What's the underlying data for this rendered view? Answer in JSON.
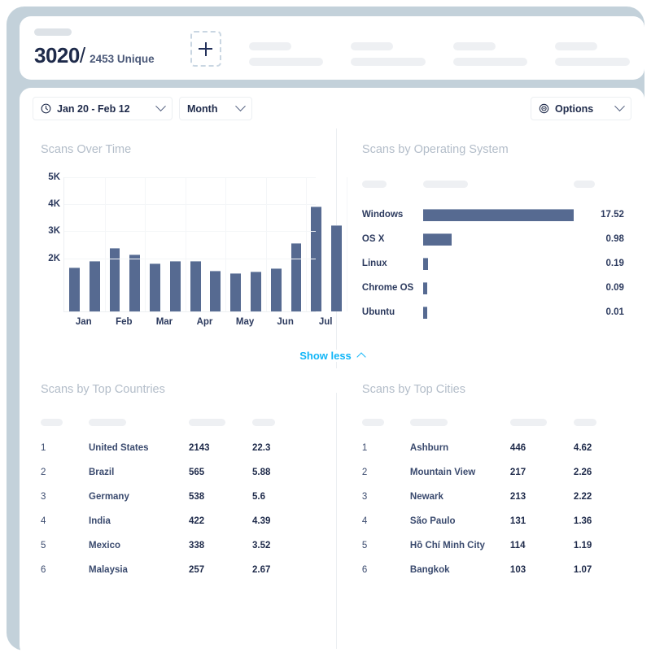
{
  "summary": {
    "total": "3020",
    "slash": "/",
    "unique": "2453 Unique",
    "add_icon": "plus-square-dashed-icon"
  },
  "toolbar": {
    "date_range": "Jan 20 - Feb 12",
    "granularity": "Month",
    "options": "Options",
    "clock_icon": "clock-icon",
    "gear_icon": "gear-icon",
    "chevron_icon": "chevron-down-icon"
  },
  "show_less": {
    "label": "Show less",
    "icon": "chevron-up-icon"
  },
  "colors": {
    "bar": "#566a91",
    "accent": "#12b6f7",
    "frame": "#c3d1da",
    "text_dark": "#1e2a4a",
    "title_muted": "#b3bdc9"
  },
  "sections": {
    "over_time": "Scans Over Time",
    "os": "Scans by Operating System",
    "countries": "Scans by Top Countries",
    "cities": "Scans by Top Cities"
  },
  "chart_data": [
    {
      "type": "bar",
      "title": "Scans Over Time",
      "xlabel": "",
      "ylabel": "",
      "ylim": [
        0,
        5000
      ],
      "yticks": [
        2000,
        3000,
        4000,
        5000
      ],
      "ytick_labels": [
        "2K",
        "3K",
        "4K",
        "5K"
      ],
      "grid": true,
      "categories": [
        "Jan",
        "Feb",
        "Mar",
        "Apr",
        "May",
        "Jun",
        "Jul"
      ],
      "values": [
        1620,
        1880,
        2340,
        2100,
        1770,
        1870,
        1860,
        1500,
        1410,
        1490,
        1600,
        2520,
        3900,
        3200
      ],
      "bar_values": [
        1620,
        1880,
        2340,
        2100,
        1770,
        1870,
        1860,
        1500,
        1410,
        1490,
        1600,
        2520,
        3900,
        3200
      ]
    },
    {
      "type": "bar",
      "orientation": "horizontal",
      "title": "Scans by Operating System",
      "categories": [
        "Windows",
        "OS X",
        "Linux",
        "Chrome OS",
        "Ubuntu"
      ],
      "values": [
        17.52,
        0.98,
        0.19,
        0.09,
        0.01
      ],
      "value_labels": [
        "17.52",
        "0.98",
        "0.19",
        "0.09",
        "0.01"
      ],
      "xlim": [
        0,
        17.52
      ]
    }
  ],
  "os_table": {
    "header_skeletons": [
      30,
      55,
      26
    ],
    "rows": [
      {
        "name": "Windows",
        "value": "17.52",
        "bar_pct": 100
      },
      {
        "name": "OS X",
        "value": "0.98",
        "bar_pct": 19
      },
      {
        "name": "Linux",
        "value": "0.19",
        "bar_pct": 3.5
      },
      {
        "name": "Chrome OS",
        "value": "0.09",
        "bar_pct": 3.0
      },
      {
        "name": "Ubuntu",
        "value": "0.01",
        "bar_pct": 2.6
      }
    ]
  },
  "countries_table": {
    "header_skeletons": [
      27,
      46,
      45,
      28
    ],
    "rows": [
      {
        "rank": "1",
        "name": "United States",
        "count": "2143",
        "pct": "22.3"
      },
      {
        "rank": "2",
        "name": "Brazil",
        "count": "565",
        "pct": "5.88"
      },
      {
        "rank": "3",
        "name": "Germany",
        "count": "538",
        "pct": "5.6"
      },
      {
        "rank": "4",
        "name": "India",
        "count": "422",
        "pct": "4.39"
      },
      {
        "rank": "5",
        "name": "Mexico",
        "count": "338",
        "pct": "3.52"
      },
      {
        "rank": "6",
        "name": "Malaysia",
        "count": "257",
        "pct": "2.67"
      }
    ]
  },
  "cities_table": {
    "header_skeletons": [
      27,
      46,
      45,
      28
    ],
    "rows": [
      {
        "rank": "1",
        "name": "Ashburn",
        "count": "446",
        "pct": "4.62"
      },
      {
        "rank": "2",
        "name": "Mountain View",
        "count": "217",
        "pct": "2.26"
      },
      {
        "rank": "3",
        "name": "Newark",
        "count": "213",
        "pct": "2.22"
      },
      {
        "rank": "4",
        "name": "São Paulo",
        "count": "131",
        "pct": "1.36"
      },
      {
        "rank": "5",
        "name": "Hồ Chí Minh City",
        "count": "114",
        "pct": "1.19"
      },
      {
        "rank": "6",
        "name": "Bangkok",
        "count": "103",
        "pct": "1.07"
      }
    ]
  }
}
